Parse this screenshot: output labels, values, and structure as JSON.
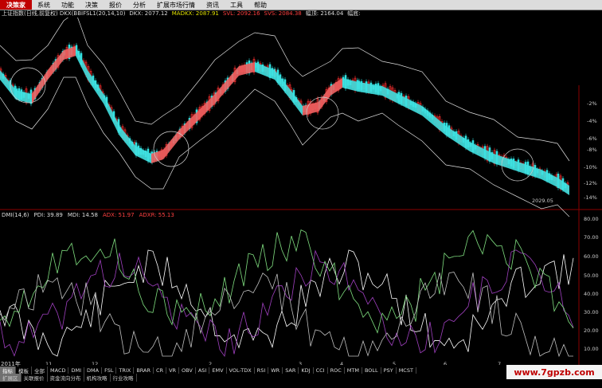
{
  "app": {
    "logo": "决策家"
  },
  "menu": [
    "系统",
    "功能",
    "决策",
    "报价",
    "分析",
    "扩展市场行情",
    "资讯",
    "工具",
    "帮助"
  ],
  "info": {
    "title": "上证指数(日线,前复权) DKX(BBIFSL1(20,14,10)",
    "dkx": "DKX: 2077.12",
    "madkx": "MADKX: 2087.91",
    "svl": "SVL: 2092.16",
    "svs": "SVS: 2084.38",
    "amp": "幅顶: 2164.04",
    "amp2": "幅底:"
  },
  "main_axis": [
    "-2%",
    "-4%",
    "-6%",
    "-8%",
    "-10%",
    "-12%",
    "-14%"
  ],
  "date_label": "2029.05",
  "dmi": {
    "title": "DMI(14,6)",
    "pdi": "PDI: 39.89",
    "mdi": "MDI: 14.58",
    "adx": "ADX: 51.97",
    "adxr": "ADXR: 55.13",
    "axis": [
      "80.00",
      "70.00",
      "60.00",
      "50.00",
      "40.00",
      "30.00",
      "20.00",
      "10.00"
    ],
    "months": [
      "11",
      "12",
      "2",
      "3",
      "4",
      "5",
      "6",
      "7"
    ]
  },
  "year": "2011年",
  "tabs_row1": [
    "指标",
    "模板",
    "全部",
    "MACD",
    "DMI",
    "DMA",
    "FSL",
    "TRIX",
    "BRAR",
    "CR",
    "VR",
    "OBV",
    "ASI",
    "EMV",
    "VOL-TDX",
    "RSI",
    "WR",
    "SAR",
    "KDJ",
    "CCI",
    "ROC",
    "MTM",
    "BOLL",
    "PSY",
    "MCST"
  ],
  "tabs_row2": [
    "扩展区",
    "关联报价",
    "资金流向分布",
    "机构攻略",
    "行业攻略"
  ],
  "watermark": "www.7gpzb.com",
  "colors": {
    "up": "#ff3030",
    "down": "#30e0e0",
    "pdi": "#ffffff",
    "mdi": "#a040c0",
    "adx": "#80e080",
    "adxr": "#c0c0c0"
  }
}
